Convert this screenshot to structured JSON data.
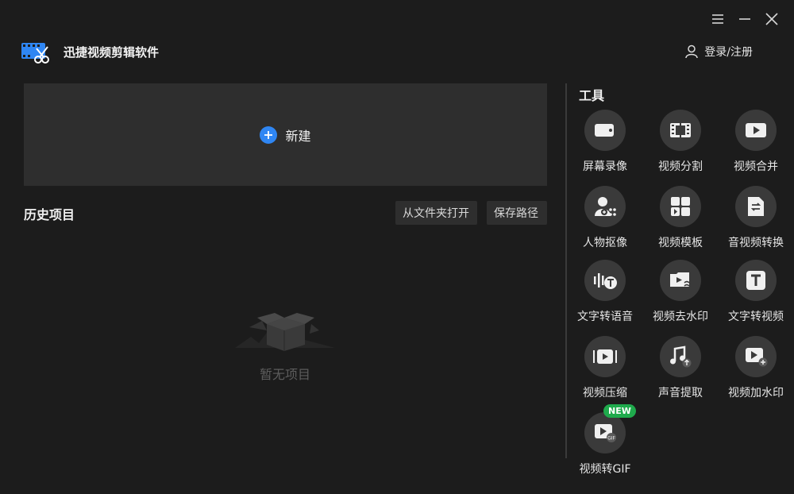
{
  "app": {
    "title": "迅捷视频剪辑软件"
  },
  "header": {
    "login_label": "登录/注册"
  },
  "new_panel": {
    "label": "新建"
  },
  "history": {
    "title": "历史项目",
    "open_folder_label": "从文件夹打开",
    "save_path_label": "保存路径",
    "empty_text": "暂无项目"
  },
  "tools": {
    "title": "工具",
    "items": [
      {
        "label": "屏幕录像",
        "icon": "camera-icon"
      },
      {
        "label": "视频分割",
        "icon": "film-split-icon"
      },
      {
        "label": "视频合并",
        "icon": "video-merge-icon"
      },
      {
        "label": "人物抠像",
        "icon": "person-cutout-icon"
      },
      {
        "label": "视频模板",
        "icon": "template-icon"
      },
      {
        "label": "音视频转换",
        "icon": "file-convert-icon"
      },
      {
        "label": "文字转语音",
        "icon": "text-to-speech-icon"
      },
      {
        "label": "视频去水印",
        "icon": "remove-watermark-icon"
      },
      {
        "label": "文字转视频",
        "icon": "text-to-video-icon"
      },
      {
        "label": "视频压缩",
        "icon": "video-compress-icon"
      },
      {
        "label": "声音提取",
        "icon": "audio-extract-icon"
      },
      {
        "label": "视频加水印",
        "icon": "add-watermark-icon"
      },
      {
        "label": "视频转GIF",
        "icon": "video-to-gif-icon",
        "badge": "NEW"
      }
    ]
  },
  "colors": {
    "background": "#1c1c1c",
    "panel": "#2e2e2e",
    "accent": "#2f86f3",
    "badge": "#1faa4c"
  }
}
